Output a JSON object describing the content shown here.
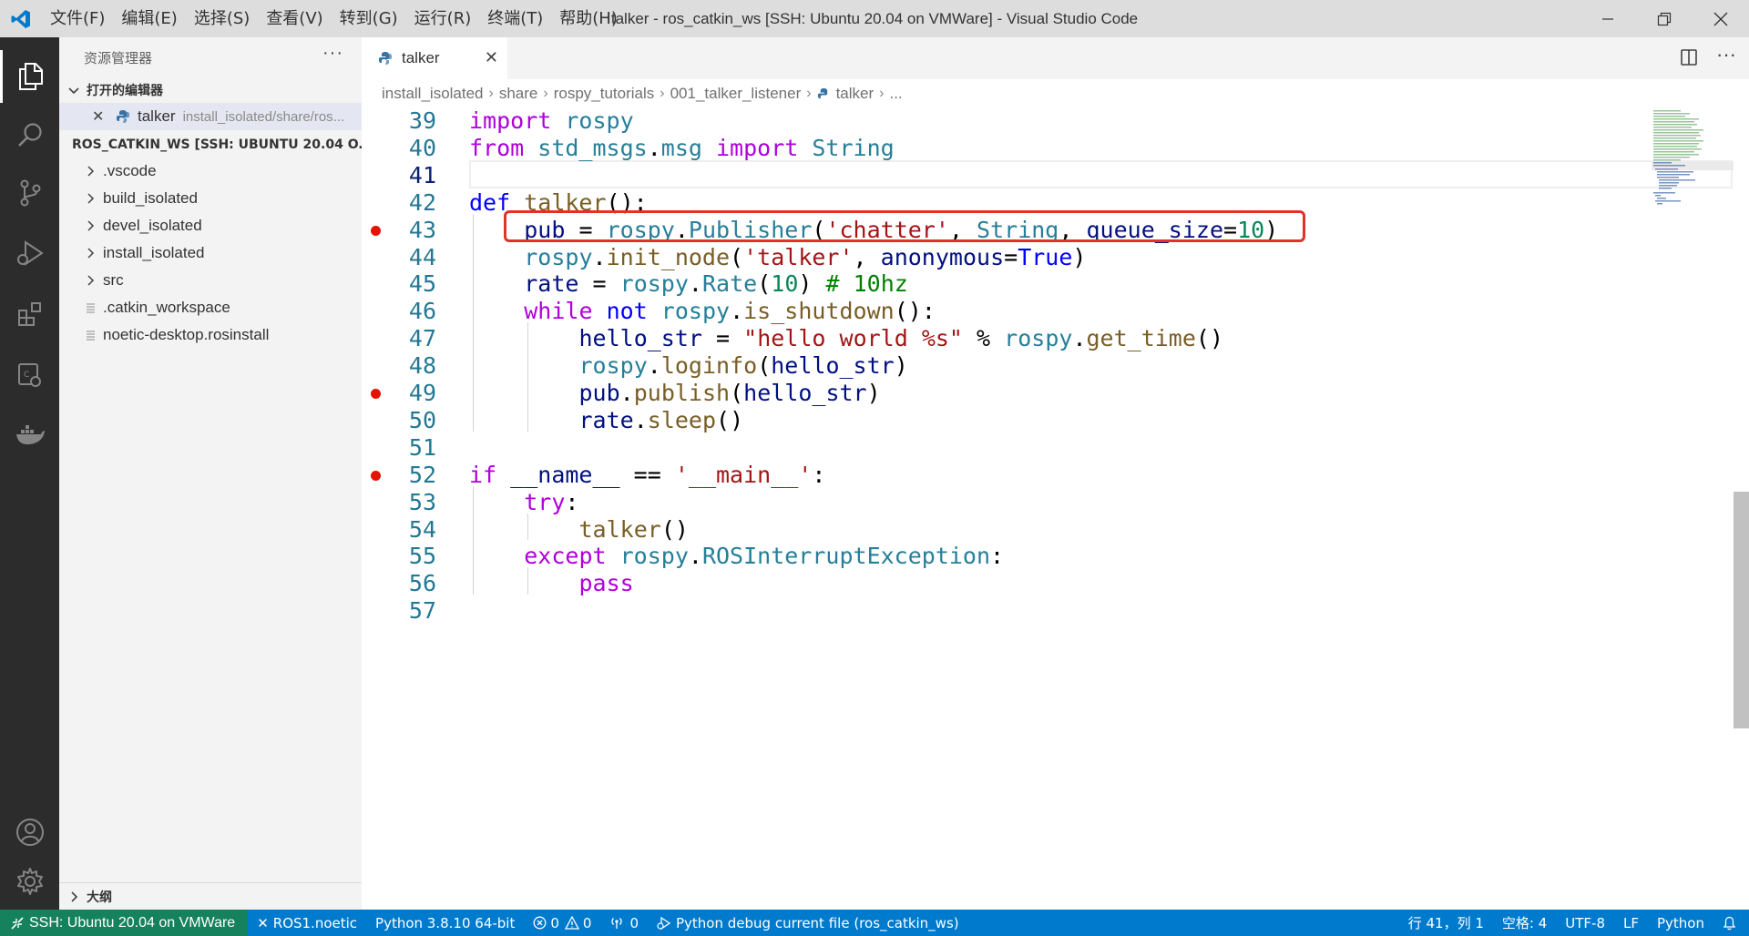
{
  "window": {
    "title": "talker - ros_catkin_ws [SSH: Ubuntu 20.04 on VMWare] - Visual Studio Code",
    "menu": [
      "文件(F)",
      "编辑(E)",
      "选择(S)",
      "查看(V)",
      "转到(G)",
      "运行(R)",
      "终端(T)",
      "帮助(H)"
    ],
    "controls": {
      "minimize": "—",
      "restore": "❐",
      "close": "✕"
    }
  },
  "activity_bar": [
    "explorer-icon",
    "search-icon",
    "source-control-icon",
    "run-debug-icon",
    "extensions-icon",
    "remote-explorer-icon",
    "docker-icon",
    "account-icon",
    "manage-gear-icon"
  ],
  "sidebar": {
    "header": "资源管理器",
    "more": "···",
    "open_editors": {
      "title": "打开的编辑器",
      "items": [
        {
          "name": "talker",
          "path": "install_isolated/share/ros..."
        }
      ]
    },
    "workspace": {
      "title": "ROS_CATKIN_WS [SSH: UBUNTU 20.04 O...",
      "items": [
        {
          "name": ".vscode",
          "type": "folder"
        },
        {
          "name": "build_isolated",
          "type": "folder"
        },
        {
          "name": "devel_isolated",
          "type": "folder"
        },
        {
          "name": "install_isolated",
          "type": "folder"
        },
        {
          "name": "src",
          "type": "folder"
        },
        {
          "name": ".catkin_workspace",
          "type": "file"
        },
        {
          "name": "noetic-desktop.rosinstall",
          "type": "file"
        }
      ]
    },
    "outline": "大纲"
  },
  "tabs": [
    {
      "label": "talker",
      "close": "✕"
    }
  ],
  "breadcrumb": [
    "install_isolated",
    "share",
    "rospy_tutorials",
    "001_talker_listener",
    "talker",
    "..."
  ],
  "editor": {
    "current_line": 41,
    "breakpoints": [
      43,
      49,
      52
    ],
    "highlighted_line": 43,
    "lines": [
      {
        "n": "39",
        "text": "import rospy"
      },
      {
        "n": "40",
        "text": "from std_msgs.msg import String"
      },
      {
        "n": "41",
        "text": ""
      },
      {
        "n": "42",
        "text": "def talker():"
      },
      {
        "n": "43",
        "text": "    pub = rospy.Publisher('chatter', String, queue_size=10)"
      },
      {
        "n": "44",
        "text": "    rospy.init_node('talker', anonymous=True)"
      },
      {
        "n": "45",
        "text": "    rate = rospy.Rate(10) # 10hz"
      },
      {
        "n": "46",
        "text": "    while not rospy.is_shutdown():"
      },
      {
        "n": "47",
        "text": "        hello_str = \"hello world %s\" % rospy.get_time()"
      },
      {
        "n": "48",
        "text": "        rospy.loginfo(hello_str)"
      },
      {
        "n": "49",
        "text": "        pub.publish(hello_str)"
      },
      {
        "n": "50",
        "text": "        rate.sleep()"
      },
      {
        "n": "51",
        "text": ""
      },
      {
        "n": "52",
        "text": "if __name__ == '__main__':"
      },
      {
        "n": "53",
        "text": "    try:"
      },
      {
        "n": "54",
        "text": "        talker()"
      },
      {
        "n": "55",
        "text": "    except rospy.ROSInterruptException:"
      },
      {
        "n": "56",
        "text": "        pass"
      },
      {
        "n": "57",
        "text": ""
      }
    ]
  },
  "status_bar": {
    "remote": "SSH: Ubuntu 20.04 on VMWare",
    "ros": "ROS1.noetic",
    "python": "Python 3.8.10 64-bit",
    "errors": "0",
    "warnings": "0",
    "ports": "0",
    "debug": "Python debug current file (ros_catkin_ws)",
    "position": "行 41，列 1",
    "spaces": "空格: 4",
    "encoding": "UTF-8",
    "eol": "LF",
    "language": "Python"
  },
  "colors": {
    "accent": "#007acc",
    "remote": "#16825d",
    "breakpoint": "#e51400",
    "highlight_box": "#e0312a"
  }
}
